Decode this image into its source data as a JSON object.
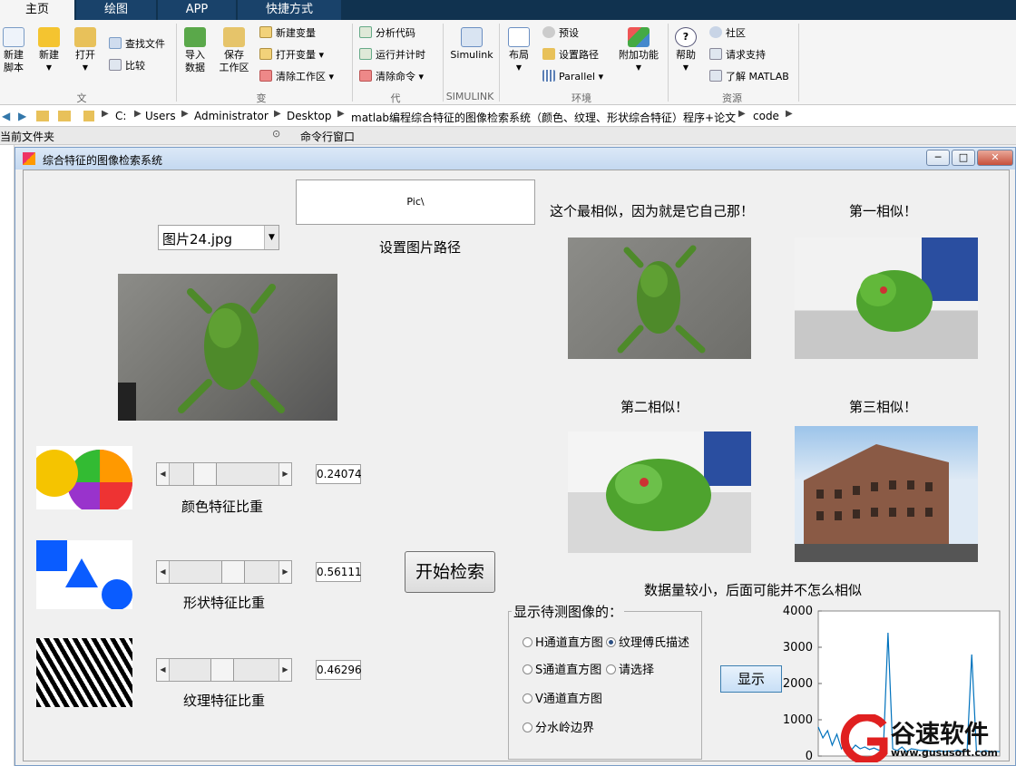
{
  "ribbon_tabs": [
    "主页",
    "绘图",
    "APP",
    "快捷方式"
  ],
  "ribbon": {
    "new_script": "新建\n脚本",
    "new": "新建",
    "open": "打开",
    "find_files": "查找文件",
    "compare": "比较",
    "import_data": "导入\n数据",
    "save_workspace": "保存\n工作区",
    "new_variable": "新建变量",
    "open_variable": "打开变量",
    "clear_workspace": "清除工作区",
    "analyze_code": "分析代码",
    "run_and_time": "运行并计时",
    "clear_commands": "清除命令",
    "simulink": "Simulink",
    "layout": "布局",
    "preferences": "预设",
    "set_path": "设置路径",
    "parallel": "Parallel",
    "addons": "附加功能",
    "help": "帮助",
    "community": "社区",
    "request_support": "请求支持",
    "learn_matlab": "了解 MATLAB",
    "groups": [
      "文件",
      "变量",
      "代码",
      "SIMULINK",
      "环境",
      "资源"
    ]
  },
  "address": {
    "crumbs": [
      "C:",
      "Users",
      "Administrator",
      "Desktop",
      "matlab编程综合特征的图像检索系统（颜色、纹理、形状综合特征）程序+论文",
      "code"
    ]
  },
  "panels": {
    "current_folder": "当前文件夹",
    "command_window": "命令行窗口"
  },
  "window": {
    "title": "综合特征的图像检索系统"
  },
  "app": {
    "path_box": "Pic\\",
    "set_path_label": "设置图片路径",
    "image_select": "图片24.jpg",
    "color_label": "颜色特征比重",
    "color_value": "0.24074",
    "color_weight": 0.24074,
    "shape_label": "形状特征比重",
    "shape_value": "0.56111",
    "shape_weight": 0.56111,
    "texture_label": "纹理特征比重",
    "texture_value": "0.46296",
    "texture_weight": 0.46296,
    "search_button": "开始检索",
    "most_similar": "这个最相似，因为就是它自己那！",
    "first_similar": "第一相似！",
    "second_similar": "第二相似！",
    "third_similar": "第三相似！",
    "note": "数据量较小，后面可能并不怎么相似",
    "display_group": "显示待测图像的：",
    "radio_h": "H通道直方图",
    "radio_s": "S通道直方图",
    "radio_v": "V通道直方图",
    "radio_watershed": "分水岭边界",
    "radio_fourier": "纹理傅氏描述",
    "radio_select": "请选择",
    "show_button": "显示"
  },
  "chart_data": {
    "type": "line",
    "ylim": [
      0,
      4000
    ],
    "yticks": [
      "4000",
      "3000",
      "2000",
      "1000",
      "0"
    ],
    "series": [
      {
        "values": [
          800,
          500,
          700,
          300,
          600,
          200,
          400,
          150,
          300,
          200,
          250,
          180,
          220,
          160,
          200,
          3400,
          200,
          150,
          250,
          120,
          200,
          180,
          150,
          160,
          140,
          130,
          150,
          120,
          140,
          130,
          160,
          120,
          140,
          2800,
          130,
          120,
          150,
          110,
          130,
          120
        ]
      }
    ]
  },
  "watermark": {
    "brand": "谷速软件",
    "url": "www.gususoft.com"
  },
  "colors": {
    "tabbar": "#10324f",
    "accent": "#0072bd",
    "title_bg": "#c4d8f0"
  }
}
